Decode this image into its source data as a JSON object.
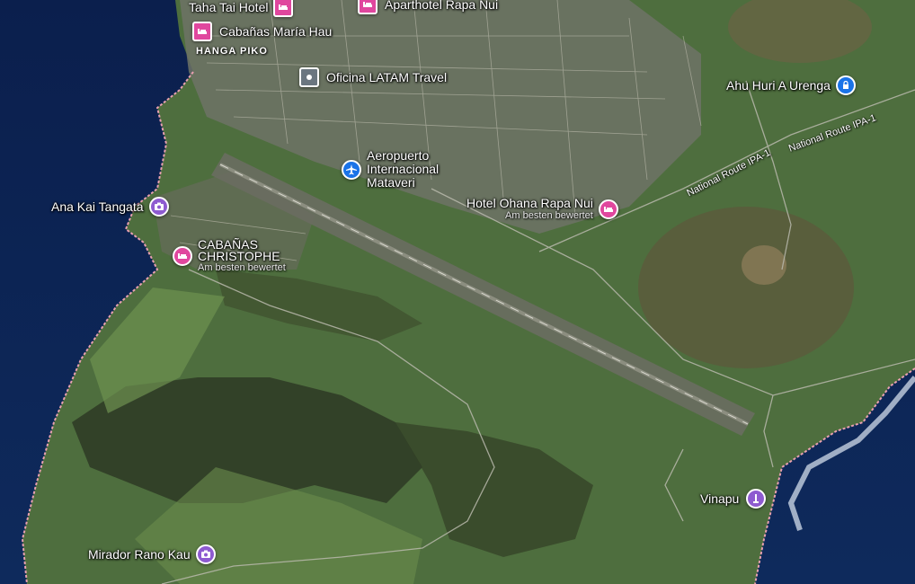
{
  "colors": {
    "ocean": "#0c2150",
    "land": "#4a6b3c",
    "poi_pink": "#e0479e",
    "poi_purple": "#8e5bd0",
    "poi_blue": "#1a73e8",
    "poi_gray": "#6b7680"
  },
  "area_label": "HANGA PIKO",
  "routes": [
    "National Route IPA-1",
    "National Route IPA-1"
  ],
  "pois": [
    {
      "name": "Taha Tai Hotel",
      "icon": "hotel-icon",
      "color": "#e0479e"
    },
    {
      "name": "Aparthotel Rapa Nui",
      "icon": "hotel-icon",
      "color": "#e0479e"
    },
    {
      "name": "Cabañas María Hau",
      "icon": "hotel-icon",
      "color": "#e0479e"
    },
    {
      "name": "Oficina LATAM Travel",
      "icon": "office-icon",
      "color": "#6b7680"
    },
    {
      "name": "Aeropuerto Internacional Mataveri",
      "icon": "airport-icon",
      "color": "#1a73e8"
    },
    {
      "name": "Ahu Huri A Urenga",
      "icon": "landmark-icon",
      "color": "#1a73e8"
    },
    {
      "name": "Ana Kai Tangata",
      "icon": "camera-icon",
      "color": "#8e5bd0"
    },
    {
      "name": "Hotel Ohana Rapa Nui",
      "icon": "hotel-icon",
      "color": "#e0479e",
      "subtitle": "Am besten bewertet"
    },
    {
      "name": "CABAÑAS CHRISTOPHE",
      "icon": "hotel-icon",
      "color": "#e0479e",
      "subtitle": "Am besten bewertet"
    },
    {
      "name": "Vinapu",
      "icon": "monument-icon",
      "color": "#8e5bd0"
    },
    {
      "name": "Mirador Rano Kau",
      "icon": "camera-icon",
      "color": "#8e5bd0"
    }
  ]
}
